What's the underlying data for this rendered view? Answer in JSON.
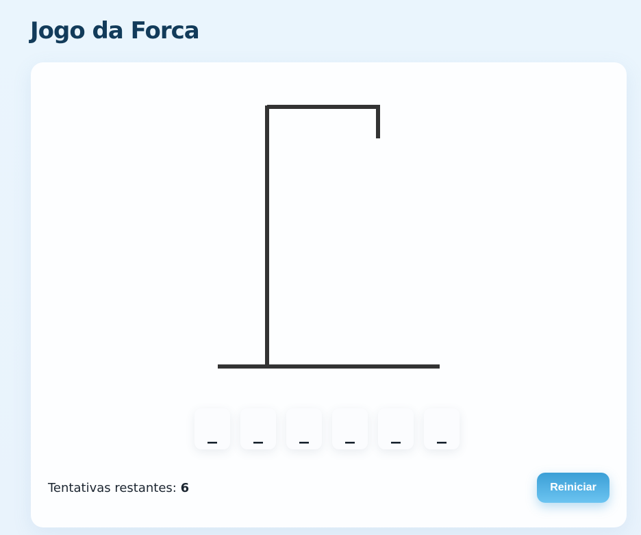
{
  "app": {
    "title": "Jogo da Forca"
  },
  "game": {
    "word_slots": [
      "_",
      "_",
      "_",
      "_",
      "_",
      "_"
    ],
    "attempts_label": "Tentativas restantes:",
    "attempts_value": "6"
  },
  "controls": {
    "restart_label": "Reiniciar"
  },
  "colors": {
    "accent": "#3b9fd6",
    "title": "#123b5a",
    "gallows": "#333333"
  },
  "icons": {
    "gallows": "hangman-gallows-icon"
  }
}
